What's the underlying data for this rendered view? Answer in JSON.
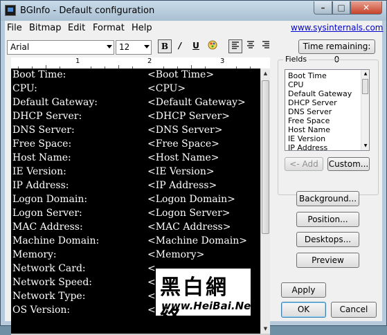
{
  "window": {
    "title": "BGInfo - Default configuration",
    "controls": {
      "minimize": "–",
      "maximize": "□",
      "close": "✕"
    }
  },
  "menu": {
    "items": [
      "File",
      "Bitmap",
      "Edit",
      "Format",
      "Help"
    ],
    "link": "www.sysinternals.com"
  },
  "toolbar": {
    "font": "Arial",
    "size": "12",
    "bold": "B",
    "italic": "/",
    "underline": "U",
    "timer_button": "Time remaining: 0"
  },
  "ruler": {
    "numbers": [
      "1",
      "2",
      "3"
    ]
  },
  "editor_rows": [
    {
      "label": "Boot Time:",
      "value": "<Boot Time>"
    },
    {
      "label": "CPU:",
      "value": "<CPU>"
    },
    {
      "label": "Default Gateway:",
      "value": "<Default Gateway>"
    },
    {
      "label": "DHCP Server:",
      "value": "<DHCP Server>"
    },
    {
      "label": "DNS Server:",
      "value": "<DNS Server>"
    },
    {
      "label": "Free Space:",
      "value": "<Free Space>"
    },
    {
      "label": "Host Name:",
      "value": "<Host Name>"
    },
    {
      "label": "IE Version:",
      "value": "<IE Version>"
    },
    {
      "label": "IP Address:",
      "value": "<IP Address>"
    },
    {
      "label": "Logon Domain:",
      "value": "<Logon Domain>"
    },
    {
      "label": "Logon Server:",
      "value": "<Logon Server>"
    },
    {
      "label": "MAC Address:",
      "value": "<MAC Address>"
    },
    {
      "label": "Machine Domain:",
      "value": "<Machine Domain>"
    },
    {
      "label": "Memory:",
      "value": "<Memory>"
    },
    {
      "label": "Network Card:",
      "value": "<"
    },
    {
      "label": "Network Speed:",
      "value": "<"
    },
    {
      "label": "Network Type:",
      "value": "<"
    },
    {
      "label": "OS Version:",
      "value": "<OS Version>"
    }
  ],
  "fields": {
    "label": "Fields",
    "items": [
      "Boot Time",
      "CPU",
      "Default Gateway",
      "DHCP Server",
      "DNS Server",
      "Free Space",
      "Host Name",
      "IE Version",
      "IP Address"
    ],
    "add_button": "<- Add",
    "custom_button": "Custom..."
  },
  "buttons": {
    "background": "Background...",
    "position": "Position...",
    "desktops": "Desktops...",
    "preview": "Preview",
    "apply": "Apply",
    "ok": "OK",
    "cancel": "Cancel"
  },
  "watermark": {
    "big": "黑白網絡",
    "url": "www.HeiBai.Net"
  }
}
